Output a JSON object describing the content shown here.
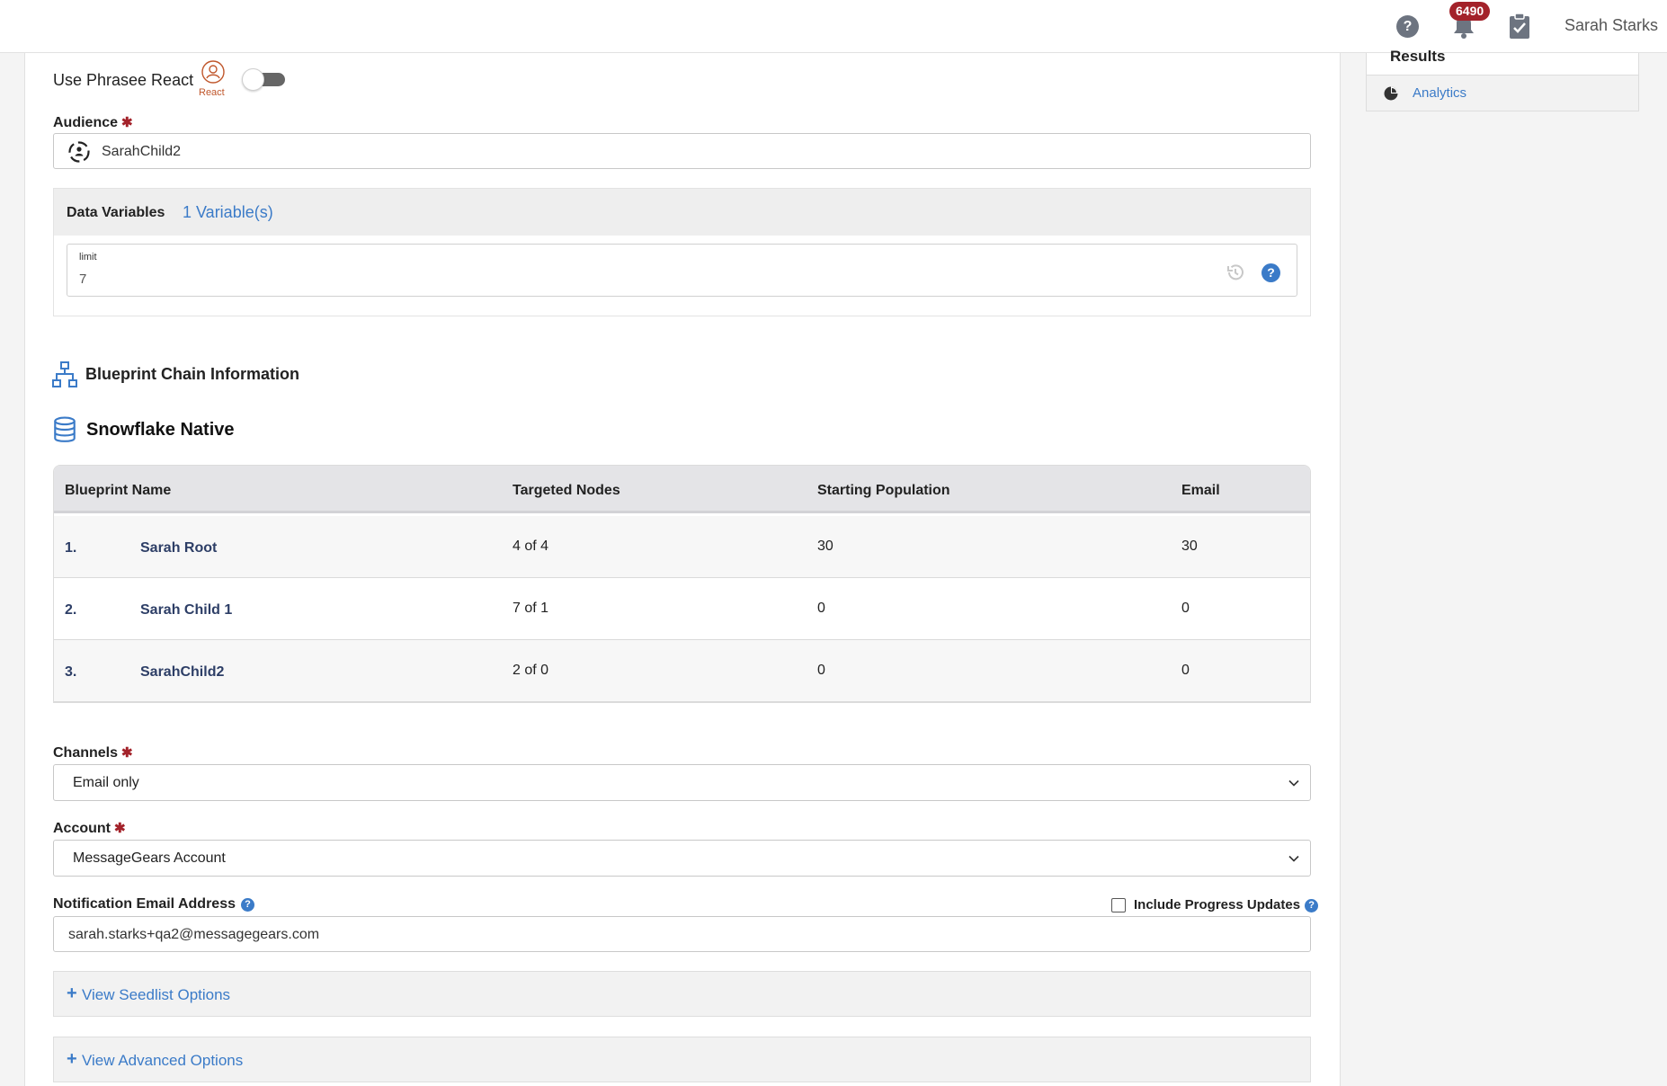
{
  "header": {
    "help_label": "?",
    "notification_count": "6490",
    "user_name": "Sarah Starks"
  },
  "side_panel": {
    "results_label": "Results",
    "analytics_label": "Analytics"
  },
  "phrasee": {
    "label": "Use Phrasee React",
    "icon_caption": "React",
    "enabled": false
  },
  "audience": {
    "label": "Audience",
    "required_mark": "✱",
    "value": "SarahChild2"
  },
  "data_variables": {
    "title": "Data Variables",
    "count_link": "1 Variable(s)",
    "field_label": "limit",
    "field_value": "7",
    "help_label": "?"
  },
  "blueprint_chain": {
    "title": "Blueprint Chain Information"
  },
  "snowflake": {
    "title": "Snowflake Native"
  },
  "table": {
    "headers": [
      "Blueprint Name",
      "Targeted Nodes",
      "Starting Population",
      "Email"
    ],
    "rows": [
      {
        "num": "1.",
        "name": "Sarah Root",
        "targeted": "4 of 4",
        "population": "30",
        "email": "30"
      },
      {
        "num": "2.",
        "name": "Sarah Child 1",
        "targeted": "7 of 1",
        "population": "0",
        "email": "0"
      },
      {
        "num": "3.",
        "name": "SarahChild2",
        "targeted": "2 of 0",
        "population": "0",
        "email": "0"
      }
    ]
  },
  "channels": {
    "label": "Channels",
    "required_mark": "✱",
    "selected": "Email only"
  },
  "account": {
    "label": "Account",
    "required_mark": "✱",
    "selected": "MessageGears Account"
  },
  "notification": {
    "label": "Notification Email Address",
    "help_label": "?",
    "value": "sarah.starks+qa2@messagegears.com",
    "include_progress_label": "Include Progress Updates",
    "include_progress_checked": false
  },
  "seedlist": {
    "plus": "+",
    "label": "View Seedlist Options"
  },
  "advanced": {
    "plus": "+",
    "label": "View Advanced Options"
  },
  "colors": {
    "accent": "#3b7bc8",
    "required": "#a3222a",
    "badge": "#a3222a",
    "react_brand": "#c0572c"
  }
}
